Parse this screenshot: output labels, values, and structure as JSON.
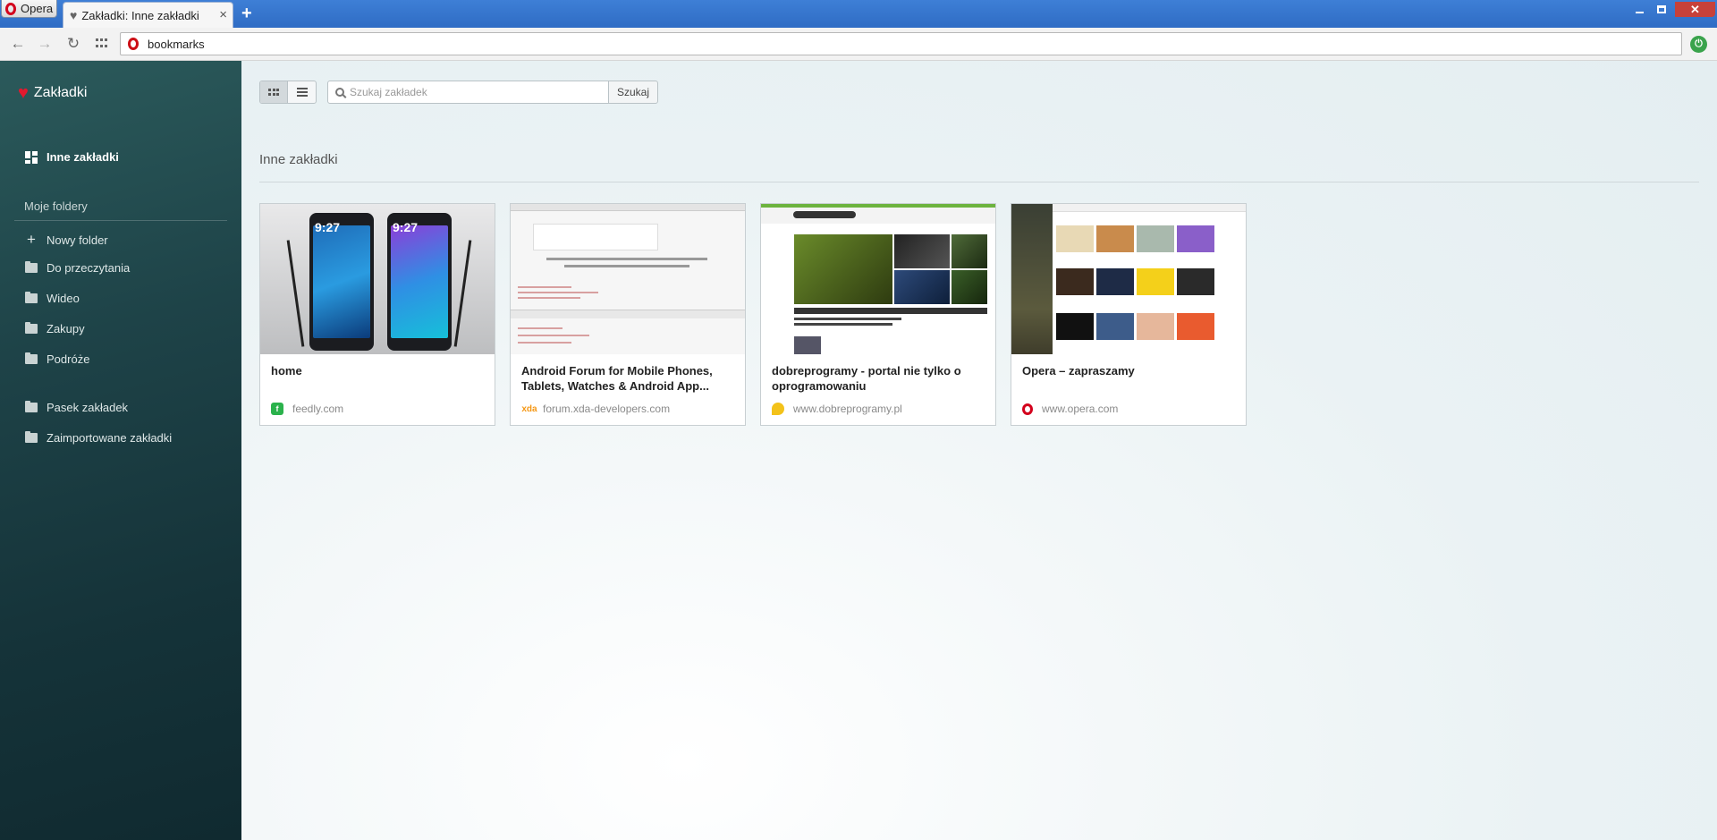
{
  "titlebar": {
    "opera_menu_label": "Opera",
    "tab_title": "Zakładki: Inne zakładki",
    "tab_close": "×",
    "new_tab": "+"
  },
  "addressbar": {
    "url": "bookmarks"
  },
  "sidebar": {
    "header": "Zakładki",
    "active_item": "Inne zakładki",
    "section_label": "Moje foldery",
    "new_folder": "Nowy folder",
    "folders": [
      "Do przeczytania",
      "Wideo",
      "Zakupy",
      "Podróże"
    ],
    "bottom_items": [
      "Pasek zakładek",
      "Zaimportowane zakładki"
    ]
  },
  "main": {
    "search_placeholder": "Szukaj zakładek",
    "search_button": "Szukaj",
    "section_title": "Inne zakładki",
    "view_mode": "grid",
    "bookmarks": [
      {
        "title": "home",
        "domain": "feedly.com",
        "favicon": "feedly-icon"
      },
      {
        "title": "Android Forum for Mobile Phones, Tablets, Watches & Android App...",
        "domain": "forum.xda-developers.com",
        "favicon": "xda-icon",
        "favicon_text": "xda"
      },
      {
        "title": "dobreprogramy - portal nie tylko o oprogramowaniu",
        "domain": "www.dobreprogramy.pl",
        "favicon": "dobreprogramy-icon"
      },
      {
        "title": "Opera – zapraszamy",
        "domain": "www.opera.com",
        "favicon": "opera-icon"
      }
    ]
  },
  "thumbnails": {
    "phones_clock": "9:27"
  },
  "colors": {
    "titlebar": "#2f6cc4",
    "opera_red": "#d3001c",
    "sidebar": "#1e4348",
    "heart": "#e3192e"
  }
}
